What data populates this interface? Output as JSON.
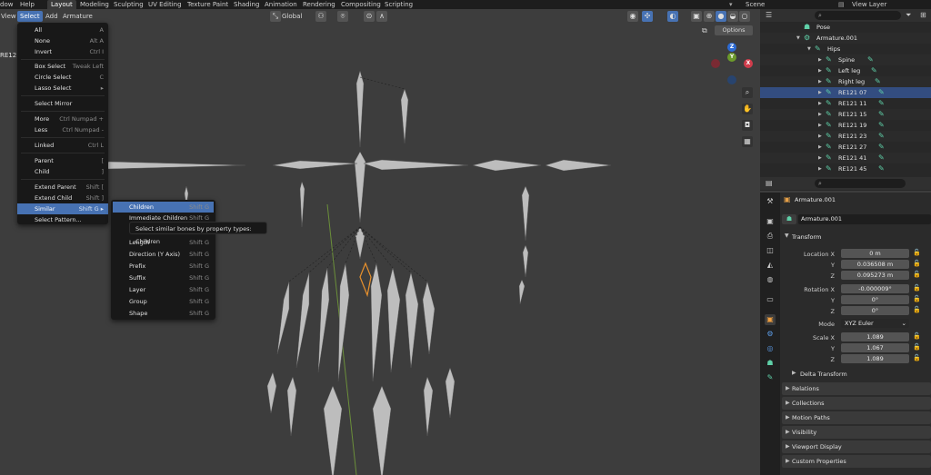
{
  "topbar": {
    "menus": [
      "dow",
      "Help"
    ],
    "workspaces": [
      "Layout",
      "Modeling",
      "Sculpting",
      "UV Editing",
      "Texture Paint",
      "Shading",
      "Animation",
      "Rendering",
      "Compositing",
      "Scripting"
    ],
    "active_workspace": "Layout",
    "scene_label": "Scene",
    "view_layer_label": "View Layer"
  },
  "viewport_header": {
    "menus": [
      "View",
      "Select",
      "Add",
      "Armature"
    ],
    "transform_orientation": "Global",
    "options_label": "Options",
    "overlay_text_left": "RE121"
  },
  "select_menu": {
    "items": [
      {
        "label": "All",
        "shortcut": "A"
      },
      {
        "label": "None",
        "shortcut": "Alt A"
      },
      {
        "label": "Invert",
        "shortcut": "Ctrl I"
      },
      {
        "label": "Box Select",
        "shortcut": "Tweak Left"
      },
      {
        "label": "Circle Select",
        "shortcut": "C"
      },
      {
        "label": "Lasso Select",
        "shortcut": "▸"
      },
      {
        "label": "Select Mirror",
        "shortcut": ""
      },
      {
        "label": "More",
        "shortcut": "Ctrl Numpad +"
      },
      {
        "label": "Less",
        "shortcut": "Ctrl Numpad -"
      },
      {
        "label": "Linked",
        "shortcut": "Ctrl L"
      },
      {
        "label": "Parent",
        "shortcut": "["
      },
      {
        "label": "Child",
        "shortcut": "]"
      },
      {
        "label": "Extend Parent",
        "shortcut": "Shift ["
      },
      {
        "label": "Extend Child",
        "shortcut": "Shift ]"
      },
      {
        "label": "Similar",
        "shortcut": "Shift G ▸"
      },
      {
        "label": "Select Pattern...",
        "shortcut": ""
      }
    ]
  },
  "similar_submenu": {
    "items": [
      {
        "label": "Children",
        "shortcut": "Shift G"
      },
      {
        "label": "Immediate Children",
        "shortcut": "Shift G"
      },
      {
        "label": "Length",
        "shortcut": "Shift G"
      },
      {
        "label": "Direction (Y Axis)",
        "shortcut": "Shift G"
      },
      {
        "label": "Prefix",
        "shortcut": "Shift G"
      },
      {
        "label": "Suffix",
        "shortcut": "Shift G"
      },
      {
        "label": "Layer",
        "shortcut": "Shift G"
      },
      {
        "label": "Group",
        "shortcut": "Shift G"
      },
      {
        "label": "Shape",
        "shortcut": "Shift G"
      }
    ],
    "tooltip": "Select similar bones by property types:  Children"
  },
  "gizmo": {
    "z": "Z",
    "y": "Y",
    "x": "X"
  },
  "outliner": {
    "rows": [
      {
        "label": "Pose",
        "icon": "pose-icon"
      },
      {
        "label": "Armature.001",
        "icon": "armature-data-icon"
      },
      {
        "label": "Hips",
        "icon": "bone-icon"
      },
      {
        "label": "Spine",
        "icon": "bone-icon"
      },
      {
        "label": "Left leg",
        "icon": "bone-icon"
      },
      {
        "label": "Right leg",
        "icon": "bone-icon"
      },
      {
        "label": "RE121 07",
        "icon": "bone-icon"
      },
      {
        "label": "RE121 11",
        "icon": "bone-icon"
      },
      {
        "label": "RE121 15",
        "icon": "bone-icon"
      },
      {
        "label": "RE121 19",
        "icon": "bone-icon"
      },
      {
        "label": "RE121 23",
        "icon": "bone-icon"
      },
      {
        "label": "RE121 27",
        "icon": "bone-icon"
      },
      {
        "label": "RE121 41",
        "icon": "bone-icon"
      },
      {
        "label": "RE121 45",
        "icon": "bone-icon"
      }
    ]
  },
  "properties": {
    "object_name": "Armature.001",
    "data_name": "Armature.001",
    "transform_title": "Transform",
    "location": {
      "label": "Location X",
      "x": "0 m",
      "y": "0.036508 m",
      "z": "0.095273 m"
    },
    "rotation": {
      "label": "Rotation X",
      "x": "-0.000009°",
      "y": "0°",
      "z": "0°"
    },
    "mode": {
      "label": "Mode",
      "value": "XYZ Euler"
    },
    "scale": {
      "label": "Scale X",
      "x": "1.089",
      "y": "1.067",
      "z": "1.089"
    },
    "axis_y": "Y",
    "axis_z": "Z",
    "sections": [
      "Delta Transform",
      "Relations",
      "Collections",
      "Motion Paths",
      "Visibility",
      "Viewport Display",
      "Custom Properties"
    ]
  }
}
